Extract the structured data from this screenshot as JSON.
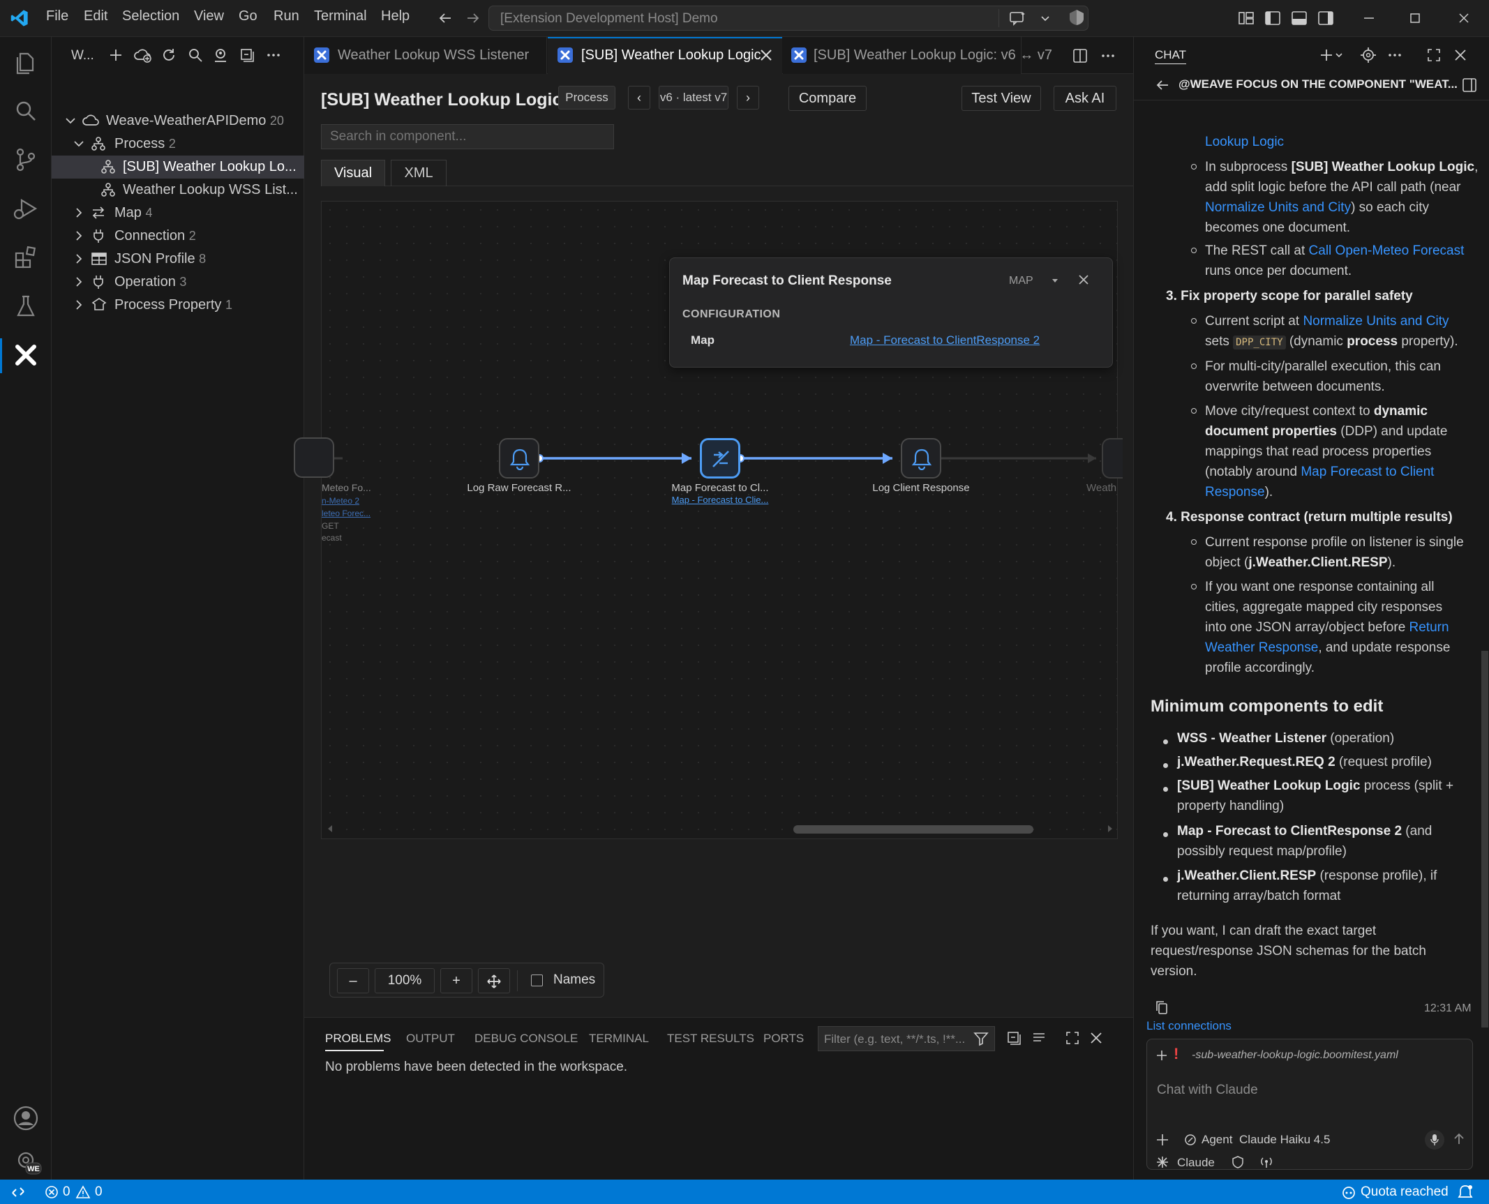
{
  "menu": [
    "File",
    "Edit",
    "Selection",
    "View",
    "Go",
    "Run",
    "Terminal",
    "Help"
  ],
  "command_center": "[Extension Development Host] Demo",
  "sidebar": {
    "title": "W...",
    "root": {
      "label": "Weave-WeatherAPIDemo",
      "count": "20"
    },
    "items": [
      {
        "label": "Process",
        "count": "2"
      },
      {
        "label": "[SUB] Weather Lookup Lo..."
      },
      {
        "label": "Weather Lookup WSS List..."
      },
      {
        "label": "Map",
        "count": "4"
      },
      {
        "label": "Connection",
        "count": "2"
      },
      {
        "label": "JSON Profile",
        "count": "8"
      },
      {
        "label": "Operation",
        "count": "3"
      },
      {
        "label": "Process Property",
        "count": "1"
      }
    ]
  },
  "tabs": [
    {
      "label": "Weather Lookup WSS Listener"
    },
    {
      "label": "[SUB] Weather Lookup Logic"
    },
    {
      "label": "[SUB] Weather Lookup Logic: v6 ↔ v7"
    }
  ],
  "component": {
    "title": "[SUB] Weather Lookup Logic",
    "type_badge": "Process",
    "prev": "‹",
    "version": "v6 · latest v7",
    "next": "›",
    "compare": "Compare",
    "test_view": "Test View",
    "ask_ai": "Ask AI",
    "search_placeholder": "Search in component...",
    "view_tabs": [
      "Visual",
      "XML"
    ]
  },
  "popup": {
    "title": "Map Forecast to Client Response",
    "type": "MAP",
    "section": "CONFIGURATION",
    "field_label": "Map",
    "field_value": "Map - Forecast to ClientResponse 2"
  },
  "nodes": [
    {
      "label": "Log Raw Forecast R..."
    },
    {
      "label": "Map Forecast to Cl...",
      "sublabel": "Map - Forecast to Clie..."
    },
    {
      "label": "Log Client Response"
    }
  ],
  "left_partial": [
    "Meteo Fo...",
    "n-Meteo 2",
    "leteo Forec...",
    "GET",
    "ecast"
  ],
  "right_partial": "Weath",
  "zoom": {
    "minus": "–",
    "value": "100%",
    "plus": "+",
    "names_label": "Names"
  },
  "panel": {
    "tabs": [
      "PROBLEMS",
      "OUTPUT",
      "DEBUG CONSOLE",
      "TERMINAL",
      "TEST RESULTS",
      "PORTS"
    ],
    "filter_placeholder": "Filter (e.g. text, **/*.ts, !**...",
    "message": "No problems have been detected in the workspace."
  },
  "chat": {
    "header": "CHAT",
    "focus_title": "@WEAVE FOCUS ON THE COMPONENT \"WEAT...",
    "top_link": "Lookup Logic",
    "step3": "3. Fix property scope for parallel safety",
    "step4": "4. Response contract (return multiple results)",
    "heading": "Minimum components to edit",
    "min_items": [
      {
        "bold": "WSS - Weather Listener",
        "rest": " (operation)"
      },
      {
        "bold": "j.Weather.Request.REQ 2",
        "rest": " (request profile)"
      },
      {
        "bold": "[SUB] Weather Lookup Logic",
        "rest": " process (split +"
      },
      {
        "bold": "",
        "rest": "property handling)"
      },
      {
        "bold": "Map - Forecast to ClientResponse 2",
        "rest": " (and"
      },
      {
        "bold": "",
        "rest": "possibly request map/profile)"
      },
      {
        "bold": "j.Weather.Client.RESP",
        "rest": " (response profile), if"
      },
      {
        "bold": "",
        "rest": "returning array/batch format"
      }
    ],
    "closing": [
      "If you want, I can draft the exact target",
      "request/response JSON schemas for the batch",
      "version."
    ],
    "timestamp": "12:31 AM",
    "list_connections": "List connections",
    "context_file": "-sub-weather-lookup-logic.boomitest.yaml",
    "input_placeholder": "Chat with Claude",
    "mode": "Agent",
    "model": "Claude Haiku 4.5",
    "footer_label": "Claude"
  },
  "status": {
    "errors": "0",
    "warnings": "0",
    "quota": "Quota reached"
  },
  "colors": {
    "accent": "#0078d4",
    "link": "#3794ff",
    "node_active": "#4d9cf4",
    "edge": "#6ea8ff"
  }
}
